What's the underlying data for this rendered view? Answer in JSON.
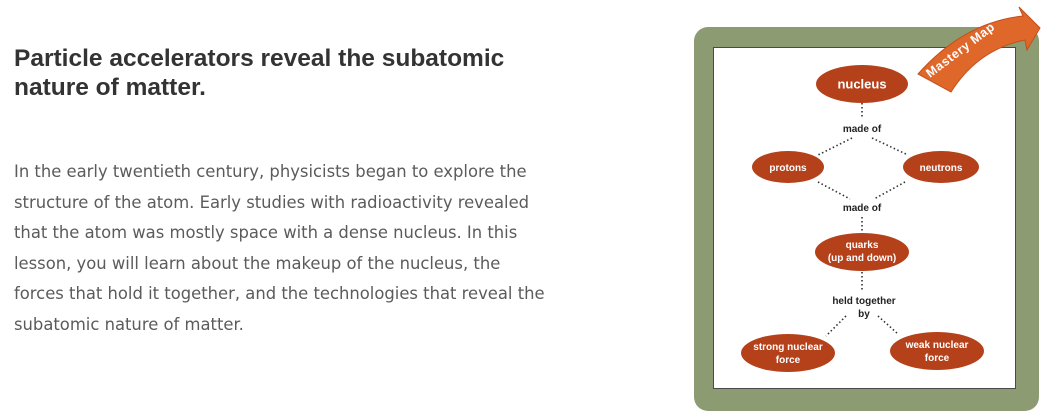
{
  "heading": [
    "Particle accelerators reveal the subatomic",
    "nature of matter."
  ],
  "paragraph": [
    "In the early twentieth century, physicists began to explore the",
    "structure of the atom. Early studies with radioactivity revealed",
    "that the atom was mostly space with a dense nucleus. In this",
    "lesson, you will learn about the makeup of the nucleus, the",
    "forces that hold it together, and the technologies that reveal the",
    "subatomic nature of matter."
  ],
  "mastery_map": {
    "banner": "Mastery Map",
    "nodes": {
      "nucleus": [
        "nucleus"
      ],
      "protons": [
        "protons"
      ],
      "neutrons": [
        "neutrons"
      ],
      "quarks": [
        "quarks",
        "(up and down)"
      ],
      "strong": [
        "strong nuclear",
        "force"
      ],
      "weak": [
        "weak nuclear",
        "force"
      ]
    },
    "relations": {
      "made_of_1": [
        "made of"
      ],
      "made_of_2": [
        "made of"
      ],
      "held_together": [
        "held together",
        "by"
      ]
    }
  },
  "colors": {
    "node_fill": "#b5411b",
    "frame": "#8c9b72",
    "arrow": "#e0672a",
    "heading": "#333333",
    "paragraph": "#5b5b5b"
  }
}
